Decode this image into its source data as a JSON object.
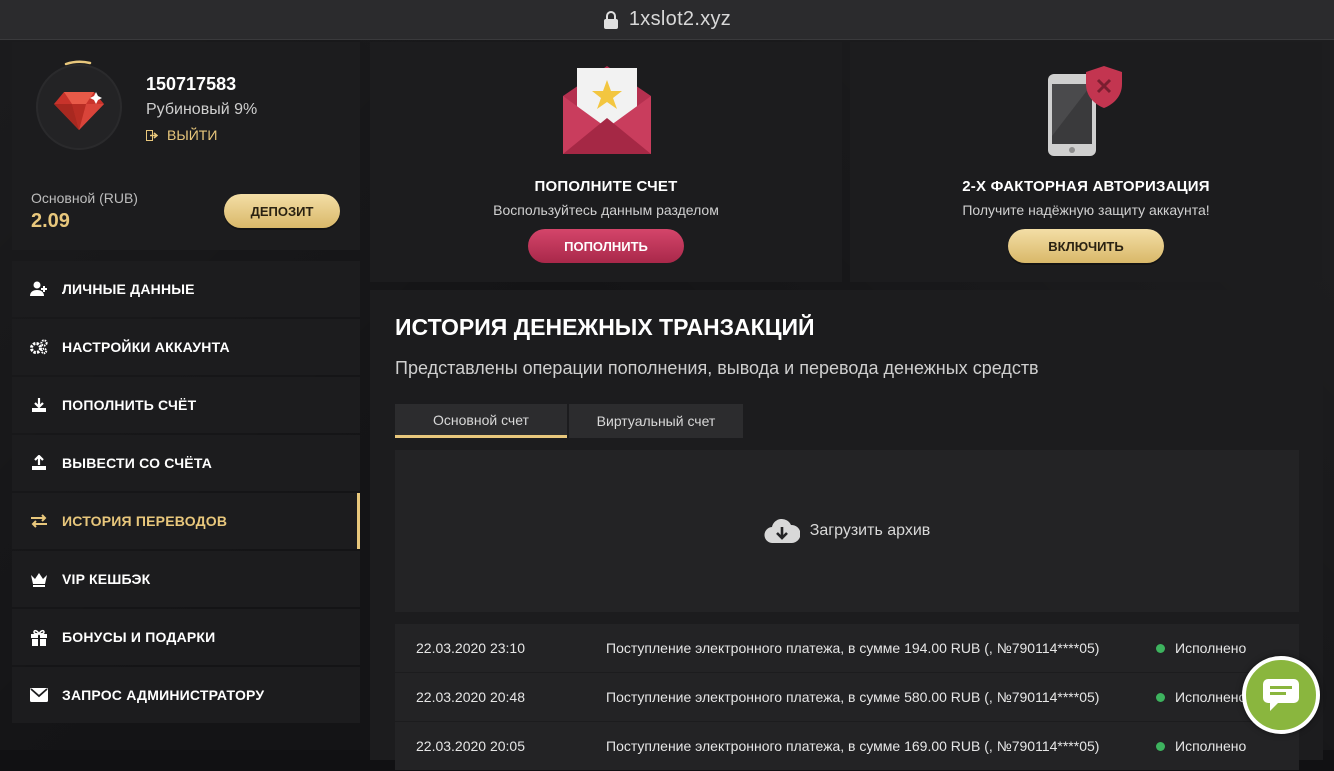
{
  "browser": {
    "url": "1xslot2.xyz",
    "lock_icon": "lock-icon"
  },
  "profile": {
    "user_id": "150717583",
    "level": "Рубиновый 9%",
    "logout_label": "ВЫЙТИ",
    "balance_label": "Основной (RUB)",
    "balance_value": "2.09",
    "deposit_label": "ДЕПОЗИТ",
    "avatar_icon": "ruby-gem-icon"
  },
  "menu": {
    "items": [
      {
        "label": "ЛИЧНЫЕ ДАННЫЕ",
        "icon": "user-plus-icon"
      },
      {
        "label": "НАСТРОЙКИ АККАУНТА",
        "icon": "gears-icon"
      },
      {
        "label": "ПОПОЛНИТЬ СЧЁТ",
        "icon": "download-icon"
      },
      {
        "label": "ВЫВЕСТИ СО СЧЁТА",
        "icon": "upload-icon"
      },
      {
        "label": "ИСТОРИЯ ПЕРЕВОДОВ",
        "icon": "transfer-arrows-icon",
        "active": true
      },
      {
        "label": "VIP КЕШБЭК",
        "icon": "crown-icon"
      },
      {
        "label": "БОНУСЫ И ПОДАРКИ",
        "icon": "gift-icon"
      },
      {
        "label": "ЗАПРОС АДМИНИСТРАТОРУ",
        "icon": "envelope-icon"
      }
    ]
  },
  "cards": {
    "deposit": {
      "title": "ПОПОЛНИТЕ СЧЕТ",
      "subtitle": "Воспользуйтесь данным разделом",
      "button": "ПОПОЛНИТЬ",
      "icon": "envelope-star-icon"
    },
    "twofa": {
      "title": "2-Х ФАКТОРНАЯ АВТОРИЗАЦИЯ",
      "subtitle": "Получите надёжную защиту аккаунта!",
      "button": "ВКЛЮЧИТЬ",
      "icon": "phone-shield-icon"
    }
  },
  "history": {
    "title": "ИСТОРИЯ ДЕНЕЖНЫХ ТРАНЗАКЦИЙ",
    "subtitle": "Представлены операции пополнения, вывода и перевода денежных средств",
    "tabs": [
      "Основной счет",
      "Виртуальный счет"
    ],
    "active_tab": 0,
    "archive_label": "Загрузить архив",
    "archive_icon": "cloud-download-icon",
    "rows": [
      {
        "date": "22.03.2020 23:10",
        "desc": "Поступление электронного платежа, в сумме 194.00 RUB (, №790114****05)",
        "status": "Исполнено"
      },
      {
        "date": "22.03.2020 20:48",
        "desc": "Поступление электронного платежа, в сумме 580.00 RUB (, №790114****05)",
        "status": "Исполнено"
      },
      {
        "date": "22.03.2020 20:05",
        "desc": "Поступление электронного платежа, в сумме 169.00 RUB (, №790114****05)",
        "status": "Исполнено"
      }
    ]
  },
  "colors": {
    "gold": "#e8c77c",
    "red": "#c13a5e",
    "success": "#3db35e",
    "chat": "#8ab63e"
  },
  "chat": {
    "icon": "chat-bubble-icon"
  }
}
